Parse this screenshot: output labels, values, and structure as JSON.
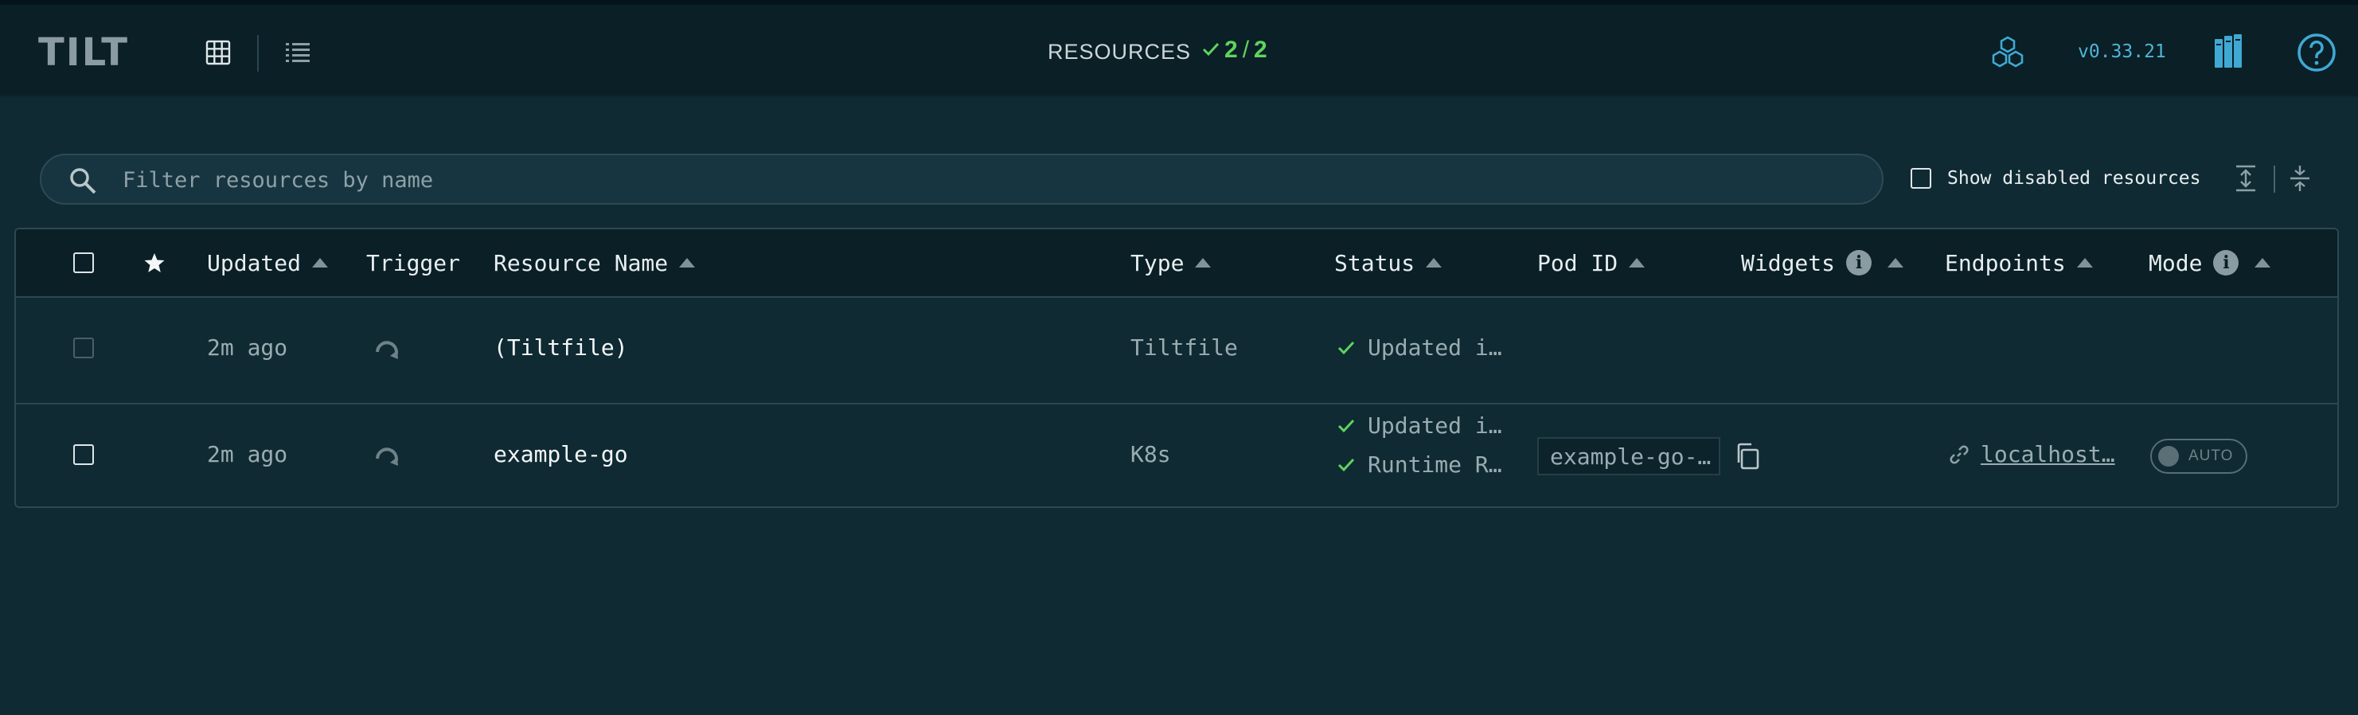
{
  "header": {
    "logo_text": "TILT",
    "resources_label": "RESOURCES",
    "resources_ok": "2",
    "resources_sep": "/",
    "resources_total": "2",
    "version": "v0.33.21"
  },
  "filter": {
    "placeholder": "Filter resources by name",
    "value": "",
    "show_disabled_label": "Show disabled resources"
  },
  "columns": {
    "updated": "Updated",
    "trigger": "Trigger",
    "resource_name": "Resource Name",
    "type": "Type",
    "status": "Status",
    "pod_id": "Pod ID",
    "widgets": "Widgets",
    "endpoints": "Endpoints",
    "mode": "Mode"
  },
  "rows": [
    {
      "updated": "2m ago",
      "name": "(Tiltfile)",
      "type": "Tiltfile",
      "status": [
        "Updated i…"
      ]
    },
    {
      "updated": "2m ago",
      "name": "example-go",
      "type": "K8s",
      "status": [
        "Updated i…",
        "Runtime R…"
      ],
      "pod_id": "example-go-…",
      "endpoint": "localhost…",
      "mode": "AUTO"
    }
  ],
  "colors": {
    "background": "#0f2a33",
    "topbar": "#0a1f26",
    "success": "#5ed45e",
    "version": "#4fb4d8",
    "icon_blue": "#3fa9d4"
  }
}
